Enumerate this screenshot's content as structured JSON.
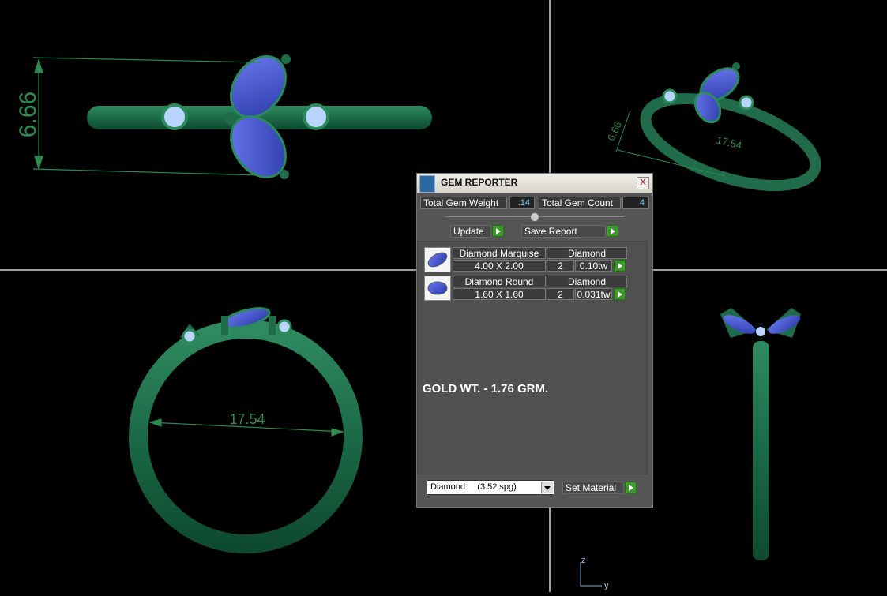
{
  "viewport": {
    "top_dim_label": "6.66",
    "iso_dim_height_label": "6.66",
    "iso_dim_width_label": "17.54",
    "front_dim_label": "17.54",
    "axis_z_label": "z",
    "axis_y_label": "y",
    "colors": {
      "metal": "#1f6b4a",
      "gem": "#4a5ad8",
      "dim_line": "#2e8a4e",
      "divider": "#c9d9e6"
    }
  },
  "gem_reporter": {
    "title": "GEM REPORTER",
    "close_label": "X",
    "total_weight_label": "Total Gem Weight",
    "total_weight_value": ".14",
    "total_count_label": "Total Gem Count",
    "total_count_value": "4",
    "update_label": "Update",
    "save_report_label": "Save Report",
    "gems": [
      {
        "name": "Diamond Marquise",
        "material": "Diamond",
        "size": "4.00 X 2.00",
        "count": "2",
        "weight": "0.10tw"
      },
      {
        "name": "Diamond Round",
        "material": "Diamond",
        "size": "1.60 X 1.60",
        "count": "2",
        "weight": "0.031tw"
      }
    ],
    "gold_weight_text": "GOLD WT. - 1.76 GRM.",
    "material_select_value": "Diamond     (3.52 spg)",
    "set_material_label": "Set Material"
  }
}
